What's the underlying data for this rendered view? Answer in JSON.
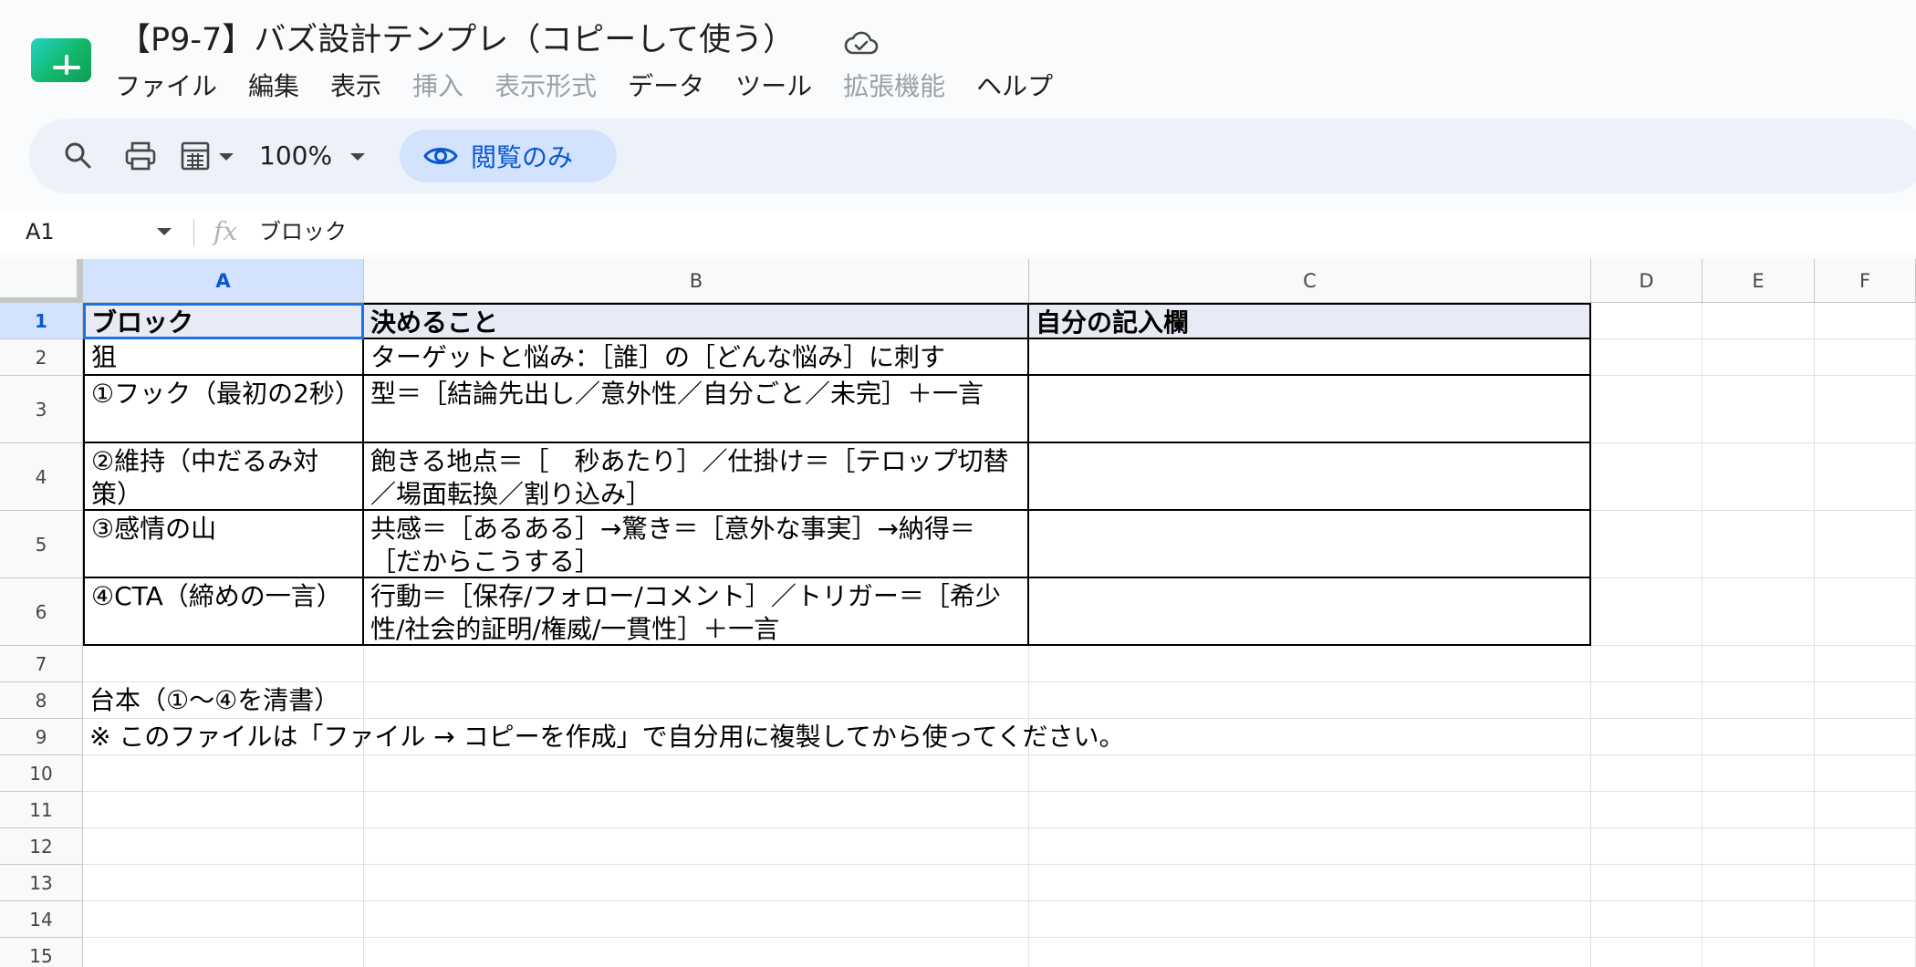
{
  "document": {
    "title": "【P9-7】バズ設計テンプレ（コピーして使う）"
  },
  "menu": {
    "items": [
      {
        "label": "ファイル",
        "disabled": false
      },
      {
        "label": "編集",
        "disabled": false
      },
      {
        "label": "表示",
        "disabled": false
      },
      {
        "label": "挿入",
        "disabled": true
      },
      {
        "label": "表示形式",
        "disabled": true
      },
      {
        "label": "データ",
        "disabled": false
      },
      {
        "label": "ツール",
        "disabled": false
      },
      {
        "label": "拡張機能",
        "disabled": true
      },
      {
        "label": "ヘルプ",
        "disabled": false
      }
    ]
  },
  "toolbar": {
    "zoom": "100%",
    "view_only_label": "閲覧のみ"
  },
  "formula_bar": {
    "cell_ref": "A1",
    "fx_symbol": "fx",
    "value": "ブロック"
  },
  "sheet": {
    "columns": [
      "A",
      "B",
      "C",
      "D",
      "E",
      "F"
    ],
    "rows": [
      "1",
      "2",
      "3",
      "4",
      "5",
      "6",
      "7",
      "8",
      "9",
      "10",
      "11",
      "12",
      "13",
      "14",
      "15"
    ],
    "selected_cell": "A1",
    "cells": {
      "A1": "ブロック",
      "B1": "決めること",
      "C1": "自分の記入欄",
      "A2": "狙",
      "B2": "ターゲットと悩み：［誰］の［どんな悩み］に刺す",
      "A3": "①フック（最初の2秒）",
      "B3": "型＝［結論先出し／意外性／自分ごと／未完］＋一言",
      "A4": "②維持（中だるみ対策）",
      "B4": "飽きる地点＝［　秒あたり］／仕掛け＝［テロップ切替／場面転換／割り込み］",
      "A5": "③感情の山",
      "B5": "共感＝［あるある］→驚き＝［意外な事実］→納得＝［だからこうする］",
      "A6": "④CTA（締めの一言）",
      "B6": "行動＝［保存/フォロー/コメント］／トリガー＝［希少性/社会的証明/権威/一貫性］＋一言",
      "A8": "台本（①〜④を清書）",
      "A9": "※ このファイルは「ファイル → コピーを作成」で自分用に複製してから使ってください。"
    }
  },
  "colors": {
    "accent": "#0b57d0",
    "selection": "#d3e3fd",
    "toolbar_bg": "#edf2fa",
    "header_row_fill": "#e8eaf6"
  },
  "icons": [
    "sheets-logo-icon",
    "cloud-check-icon",
    "search-icon",
    "print-icon",
    "calculator-icon",
    "eye-icon"
  ]
}
